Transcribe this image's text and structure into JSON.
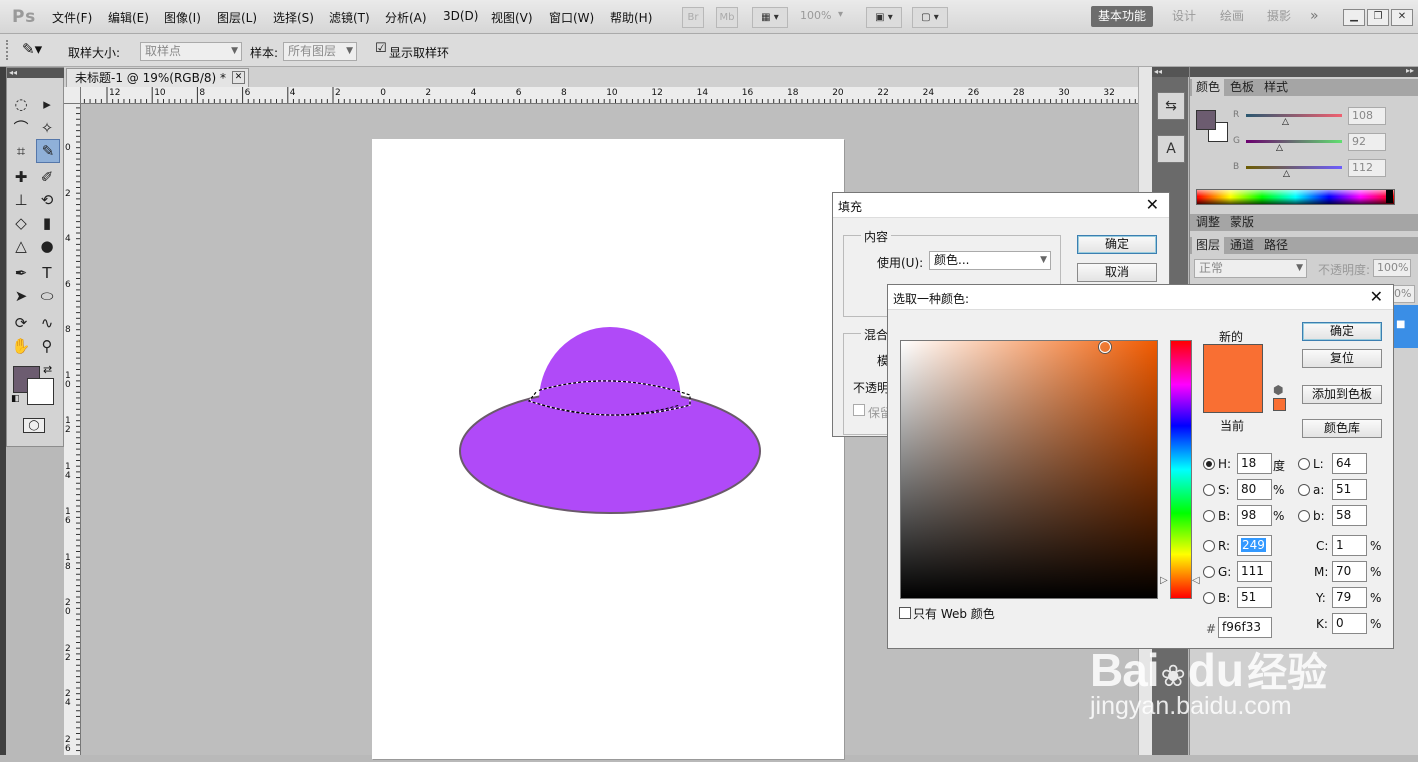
{
  "app": {
    "logo": "Ps"
  },
  "menu": [
    "文件(F)",
    "编辑(E)",
    "图像(I)",
    "图层(L)",
    "选择(S)",
    "滤镜(T)",
    "分析(A)",
    "3D(D)",
    "视图(V)",
    "窗口(W)",
    "帮助(H)"
  ],
  "toolbar_top": {
    "br": "Br",
    "mb": "Mb",
    "zoom": "100%"
  },
  "workspaces": [
    "基本功能",
    "设计",
    "绘画",
    "摄影"
  ],
  "workspace_more": "»",
  "options": {
    "sample_size_label": "取样大小:",
    "sample_size_value": "取样点",
    "sample_label": "样本:",
    "sample_value": "所有图层",
    "show_ring_label": "显示取样环",
    "show_ring_checked": "☑"
  },
  "document": {
    "tab_title": "未标题-1 @ 19%(RGB/8) *",
    "close": "✕"
  },
  "rulers": {
    "h": [
      "12",
      "10",
      "8",
      "6",
      "4",
      "2",
      "0",
      "2",
      "4",
      "6",
      "8",
      "10",
      "12",
      "14",
      "16",
      "18",
      "20",
      "22",
      "24",
      "26",
      "28",
      "30",
      "32"
    ],
    "v": [
      "0",
      "2",
      "4",
      "6",
      "8",
      "1\n0",
      "1\n2",
      "1\n4",
      "1\n6",
      "1\n8",
      "2\n0",
      "2\n2",
      "2\n4",
      "2\n6"
    ]
  },
  "color_panel": {
    "tabs": [
      "颜色",
      "色板",
      "样式"
    ],
    "r_label": "R",
    "g_label": "G",
    "b_label": "B",
    "r": "108",
    "g": "92",
    "b": "112",
    "fg_color": "#6c5c70"
  },
  "adjust_panel": {
    "tabs": [
      "调整",
      "蒙版"
    ]
  },
  "layers_panel": {
    "tabs": [
      "图层",
      "通道",
      "路径"
    ],
    "blend_mode": "正常",
    "opacity_label": "不透明度:",
    "opacity": "100%",
    "fill_value": "0%"
  },
  "fill_dialog": {
    "title": "填充",
    "contents_legend": "内容",
    "use_label": "使用(U):",
    "use_value": "颜色...",
    "blend_legend": "混合",
    "mode_label": "模",
    "opacity_label": "不透明",
    "preserve_label": "保留",
    "ok": "确定",
    "cancel": "取消"
  },
  "picker_dialog": {
    "title": "选取一种颜色:",
    "new_label": "新的",
    "current_label": "当前",
    "new_color": "#f96f33",
    "current_color": "#f96f33",
    "ok": "确定",
    "reset": "复位",
    "add_swatch": "添加到色板",
    "color_library": "颜色库",
    "web_only": "只有 Web 颜色",
    "hsb": {
      "H": "18",
      "S": "80",
      "B": "98"
    },
    "units": {
      "H": "度",
      "S": "%",
      "B": "%"
    },
    "rgb": {
      "R": "249",
      "G": "111",
      "B": "51"
    },
    "lab": {
      "L": "64",
      "a": "51",
      "b": "58"
    },
    "cmyk": {
      "C": "1",
      "M": "70",
      "Y": "79",
      "K": "0"
    },
    "cmyk_unit": "%",
    "hex_label": "#",
    "hex": "f96f33"
  },
  "canvas": {
    "hat_color": "#b04af8",
    "outline_color": "#6a5a6a"
  },
  "watermark": {
    "brand": "Bai",
    "brand2": "du",
    "cn": "经验",
    "url": "jingyan.baidu.com"
  }
}
